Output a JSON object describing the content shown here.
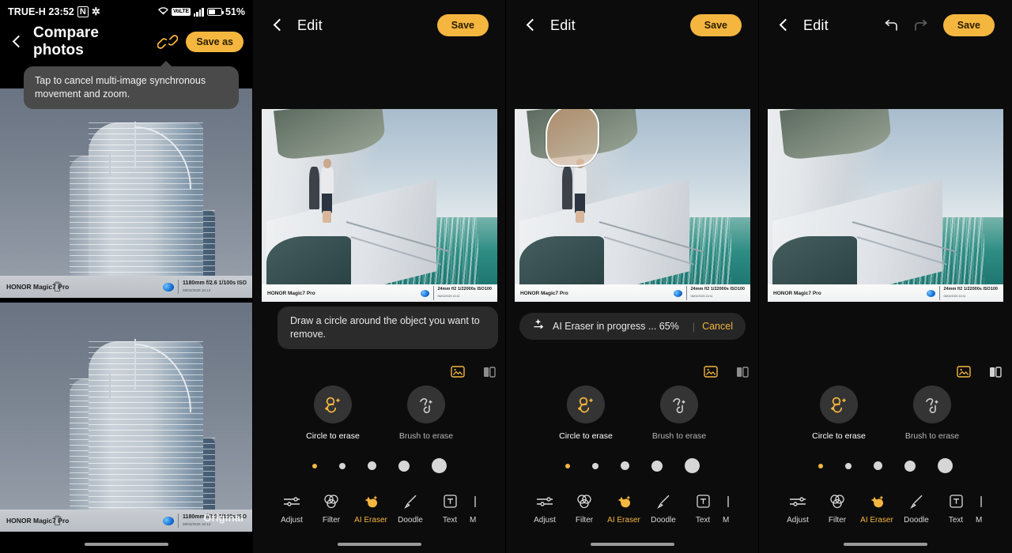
{
  "statusbar": {
    "carrier_time": "TRUE-H 23:52",
    "nfc_icon": "nfc-icon",
    "bluetooth_icon": "bluetooth-icon",
    "wifi_icon": "wifi-icon",
    "volte_label": "VoLTE",
    "signal_icon": "signal-bars-icon",
    "battery_percent": "51%",
    "battery_level": 51
  },
  "compare_panel": {
    "back_icon": "back-chevron-icon",
    "title": "Compare photos",
    "link_icon": "link-icon",
    "save_as_label": "Save as",
    "tooltip": "Tap to cancel multi-image synchronous movement and zoom.",
    "photo_top": {
      "watermark_name": "HONOR Magic7 Pro",
      "watermark_meta": "1180mm  f/2.6  1/100s  ISO",
      "watermark_date": "06/02/2025 15:13",
      "delete_icon": "trash-icon"
    },
    "photo_bottom": {
      "watermark_name": "HONOR Magic7 Pro",
      "watermark_meta": "1180mm  f/2.6  1/100s  ISO",
      "watermark_date": "06/02/2025 15:13",
      "overlay_label": "Original",
      "delete_icon": "trash-icon"
    }
  },
  "edit_common": {
    "back_icon": "back-chevron-icon",
    "title": "Edit",
    "save_label": "Save",
    "undo_icon": "undo-icon",
    "redo_icon": "redo-icon",
    "restore_icon": "restore-image-icon",
    "compare_icon": "compare-split-icon",
    "watermark_name": "HONOR Magic7 Pro",
    "watermark_meta": "24mm  f/2  1/22000s  ISO100",
    "watermark_date": "06/02/2025 15:31",
    "modes": [
      {
        "label": "Circle to erase",
        "icon": "circle-erase-icon",
        "active": true
      },
      {
        "label": "Brush to erase",
        "icon": "brush-erase-icon",
        "active": false
      }
    ],
    "brush_sizes": [
      {
        "size": 1,
        "selected": true
      },
      {
        "size": 2,
        "selected": false
      },
      {
        "size": 3,
        "selected": false
      },
      {
        "size": 4,
        "selected": false
      },
      {
        "size": 5,
        "selected": false
      }
    ],
    "toolbar": [
      {
        "label": "Adjust",
        "icon": "sliders-icon",
        "active": false
      },
      {
        "label": "Filter",
        "icon": "filter-rings-icon",
        "active": false
      },
      {
        "label": "AI Eraser",
        "icon": "ai-eraser-icon",
        "active": true
      },
      {
        "label": "Doodle",
        "icon": "brush-icon",
        "active": false
      },
      {
        "label": "Text",
        "icon": "text-box-icon",
        "active": false
      },
      {
        "label": "M",
        "icon": "more-icon",
        "active": false
      }
    ]
  },
  "edit_panel_2": {
    "hint": "Draw a circle around the object you want to remove."
  },
  "edit_panel_3": {
    "progress_icon": "ai-sparkle-icon",
    "progress_text": "AI Eraser in progress ... 65%",
    "progress_percent": 65,
    "divider": "|",
    "cancel_label": "Cancel"
  },
  "colors": {
    "accent": "#f4b63f",
    "panel_bg": "#0c0c0c",
    "bubble_bg": "#2b2b2b",
    "text": "#ffffff"
  }
}
